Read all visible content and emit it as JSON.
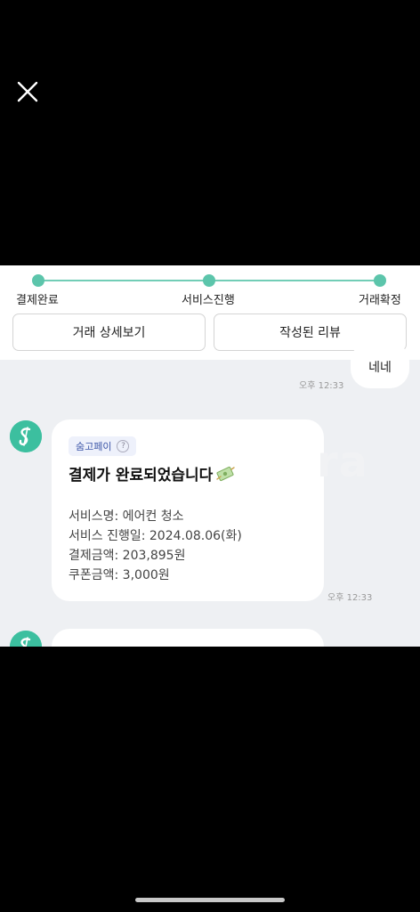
{
  "progress": {
    "steps": [
      "결제완료",
      "서비스진행",
      "거래확정"
    ],
    "accent_color": "#5cc5ab"
  },
  "actions": {
    "detail_label": "거래 상세보기",
    "review_label": "작성된 리뷰"
  },
  "chat": {
    "my_message": {
      "text": "네네",
      "time": "오후 12:33"
    },
    "payment_card": {
      "badge": "숨고페이",
      "help_glyph": "?",
      "title": "결제가 완료되었습니다",
      "watermark": "ra",
      "service_name": "서비스명: 에어컨 청소",
      "service_date": "서비스 진행일: 2024.08.06(화)",
      "payment_amount": "결제금액: 203,895원",
      "coupon_amount": "쿠폰금액: 3,000원",
      "time": "오후 12:33"
    }
  }
}
